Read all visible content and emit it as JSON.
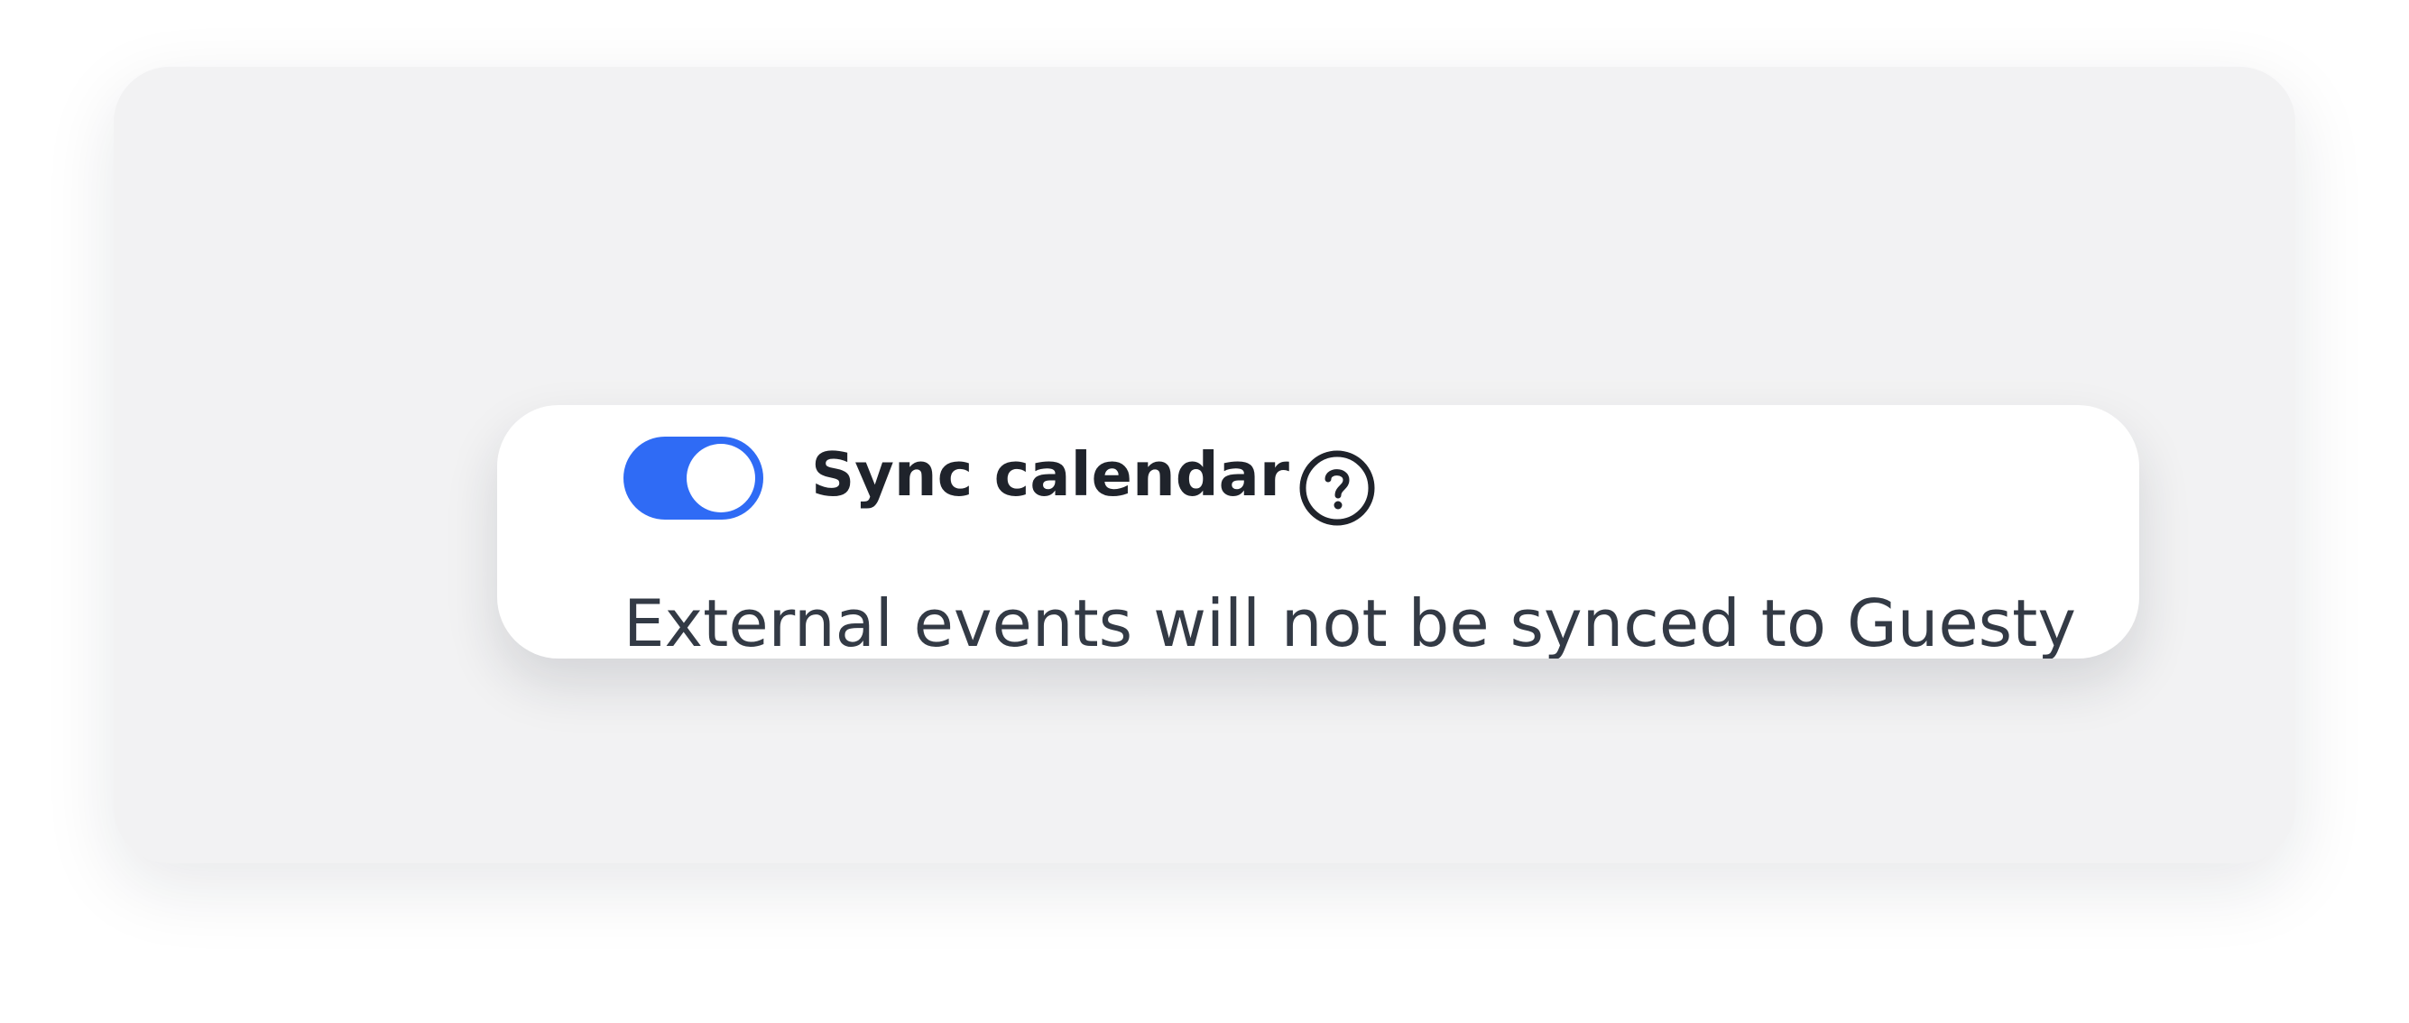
{
  "theme": {
    "accent": "#2f6bf5",
    "background": "#f2f2f3",
    "card": "#ffffff"
  },
  "setting": {
    "toggle": {
      "enabled": true
    },
    "title": "Sync calendar",
    "help_icon": "question-circle-icon",
    "description": "External events will not be synced to Guesty"
  }
}
